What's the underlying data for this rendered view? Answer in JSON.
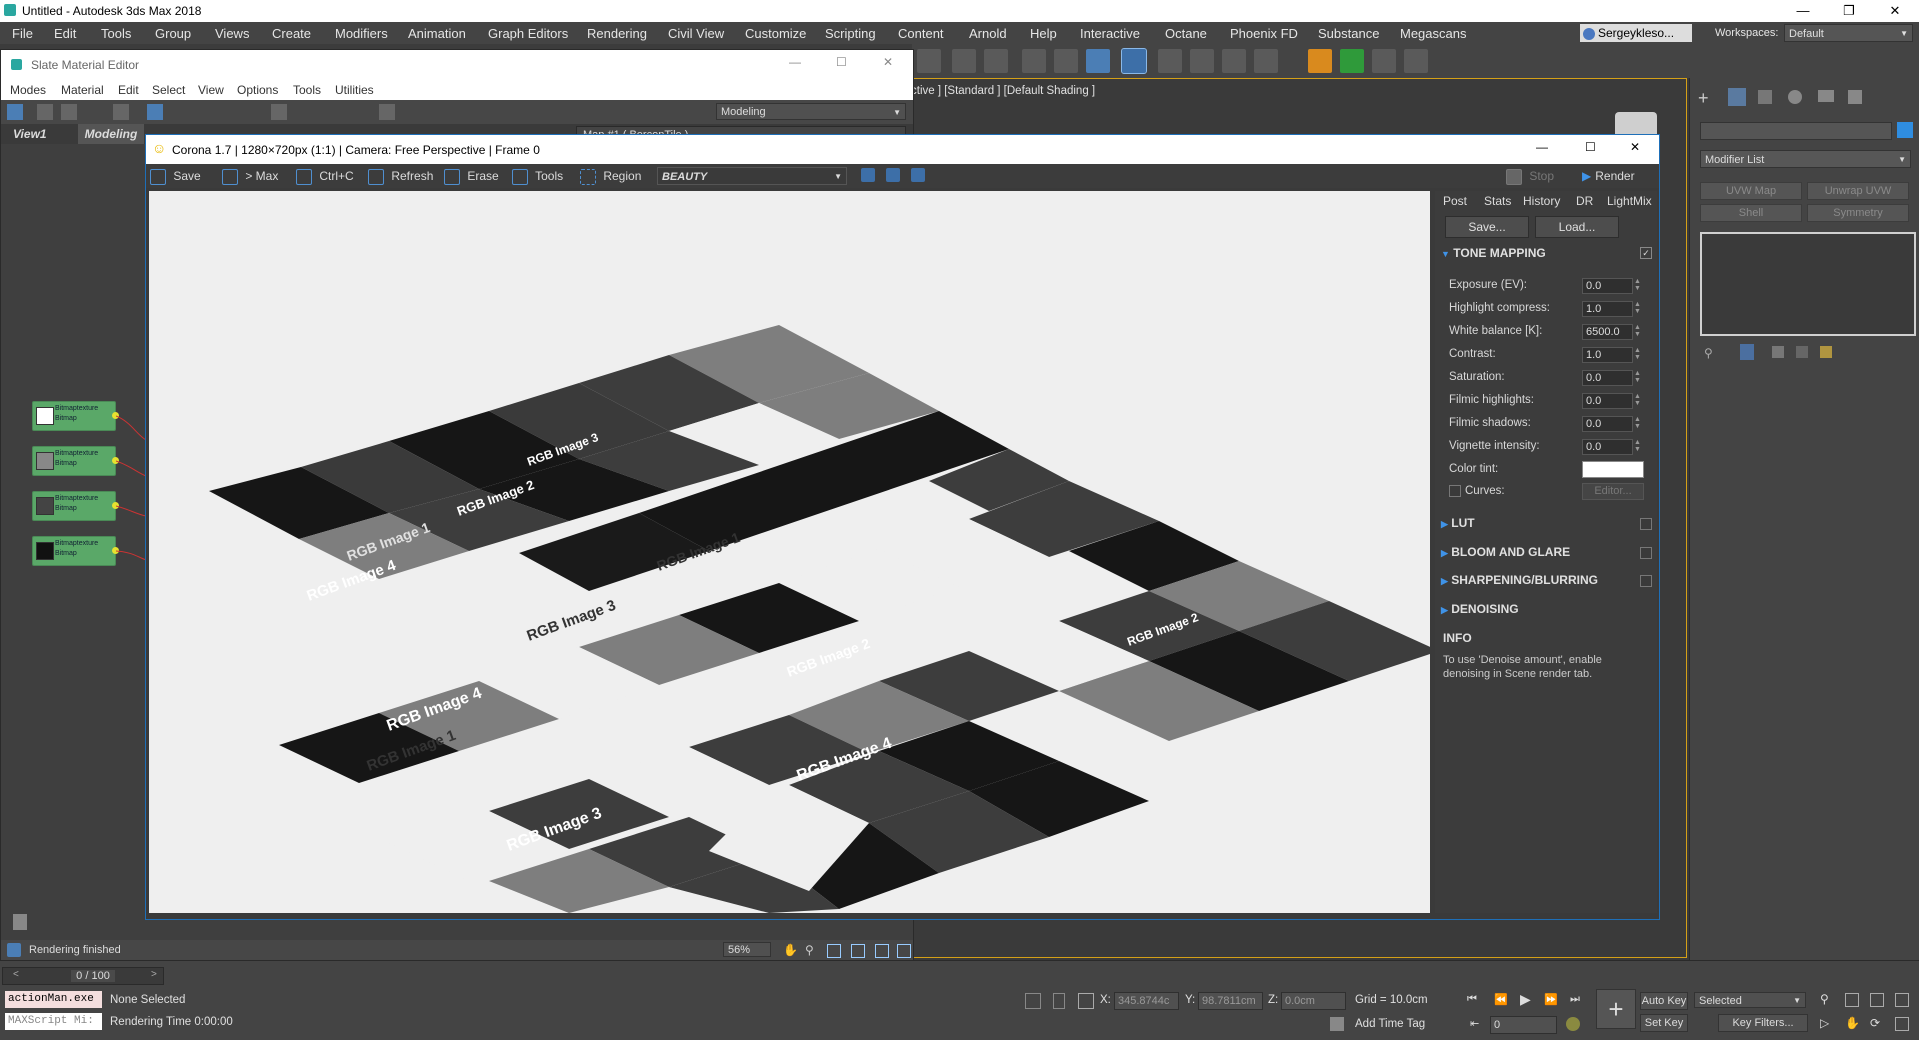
{
  "app": {
    "title": "Untitled - Autodesk 3ds Max 2018",
    "menu": [
      "File",
      "Edit",
      "Tools",
      "Group",
      "Views",
      "Create",
      "Modifiers",
      "Animation",
      "Graph Editors",
      "Rendering",
      "Civil View",
      "Customize",
      "Scripting",
      "Content",
      "Arnold",
      "Help",
      "Interactive",
      "Octane",
      "Phoenix FD",
      "Substance",
      "Megascans"
    ],
    "user": "Sergeykleso...",
    "workspaces_label": "Workspaces:",
    "workspace": "Default"
  },
  "viewport": {
    "label": "ctive ] [Standard ] [Default Shading ]"
  },
  "command_panel": {
    "modifier_list": "Modifier List",
    "buttons": [
      "UVW Map",
      "Unwrap UVW",
      "Shell",
      "Symmetry"
    ]
  },
  "slate": {
    "title": "Slate Material Editor",
    "menu": [
      "Modes",
      "Material",
      "Edit",
      "Select",
      "View",
      "Options",
      "Tools",
      "Utilities"
    ],
    "mode": "Modeling",
    "view_tab": "View1",
    "view_tab2": "Modeling",
    "map_tab": "Map #1  ( BerconTile )",
    "nodes": [
      {
        "l1": "Bitmaptexture",
        "l2": "Bitmap"
      },
      {
        "l1": "Bitmaptexture",
        "l2": "Bitmap"
      },
      {
        "l1": "Bitmaptexture",
        "l2": "Bitmap"
      },
      {
        "l1": "Bitmaptexture",
        "l2": "Bitmap"
      }
    ],
    "status": "Rendering finished",
    "zoom": "56%"
  },
  "vfb": {
    "title": "Corona 1.7 | 1280×720px (1:1) | Camera: Free Perspective | Frame 0",
    "toolbar": {
      "save": "Save",
      "max": "> Max",
      "ctrlc": "Ctrl+C",
      "refresh": "Refresh",
      "erase": "Erase",
      "tools": "Tools",
      "region": "Region",
      "channel": "BEAUTY",
      "stop": "Stop",
      "render": "Render"
    },
    "tabs": [
      "Post",
      "Stats",
      "History",
      "DR",
      "LightMix"
    ],
    "save_btn": "Save...",
    "load_btn": "Load...",
    "tone_mapping": "TONE MAPPING",
    "params": [
      {
        "label": "Exposure (EV):",
        "value": "0.0"
      },
      {
        "label": "Highlight compress:",
        "value": "1.0"
      },
      {
        "label": "White balance [K]:",
        "value": "6500.0"
      },
      {
        "label": "Contrast:",
        "value": "1.0"
      },
      {
        "label": "Saturation:",
        "value": "0.0"
      },
      {
        "label": "Filmic highlights:",
        "value": "0.0"
      },
      {
        "label": "Filmic shadows:",
        "value": "0.0"
      },
      {
        "label": "Vignette intensity:",
        "value": "0.0"
      }
    ],
    "color_tint": "Color tint:",
    "curves": "Curves:",
    "editor": "Editor...",
    "sections": [
      "LUT",
      "BLOOM AND GLARE",
      "SHARPENING/BLURRING",
      "DENOISING"
    ],
    "info_title": "INFO",
    "info_text_1": "To use 'Denoise amount', enable",
    "info_text_2": "denoising in Scene render tab.",
    "tile_labels": [
      "RGB Image 1",
      "RGB Image 2",
      "RGB Image 3",
      "RGB Image 4",
      "RGB Image 1",
      "RGB Image 3",
      "RGB Image 2",
      "RGB Image 4",
      "RGB Image 1",
      "RGB Image 3",
      "RGB Image 4",
      "RGB Image 2"
    ]
  },
  "status": {
    "frame": "0 / 100",
    "script1": "actionMan.exe",
    "script2": "MAXScript Mi:",
    "none_selected": "None Selected",
    "render_time": "Rendering Time 0:00:00",
    "x_label": "X:",
    "x": "345.8744c",
    "y_label": "Y:",
    "y": "98.7811cm",
    "z_label": "Z:",
    "z": "0.0cm",
    "grid": "Grid = 10.0cm",
    "add_time_tag": "Add Time Tag",
    "auto_key": "Auto Key",
    "set_key": "Set Key",
    "selected": "Selected",
    "key_filters": "Key Filters...",
    "frame_field": "0"
  }
}
